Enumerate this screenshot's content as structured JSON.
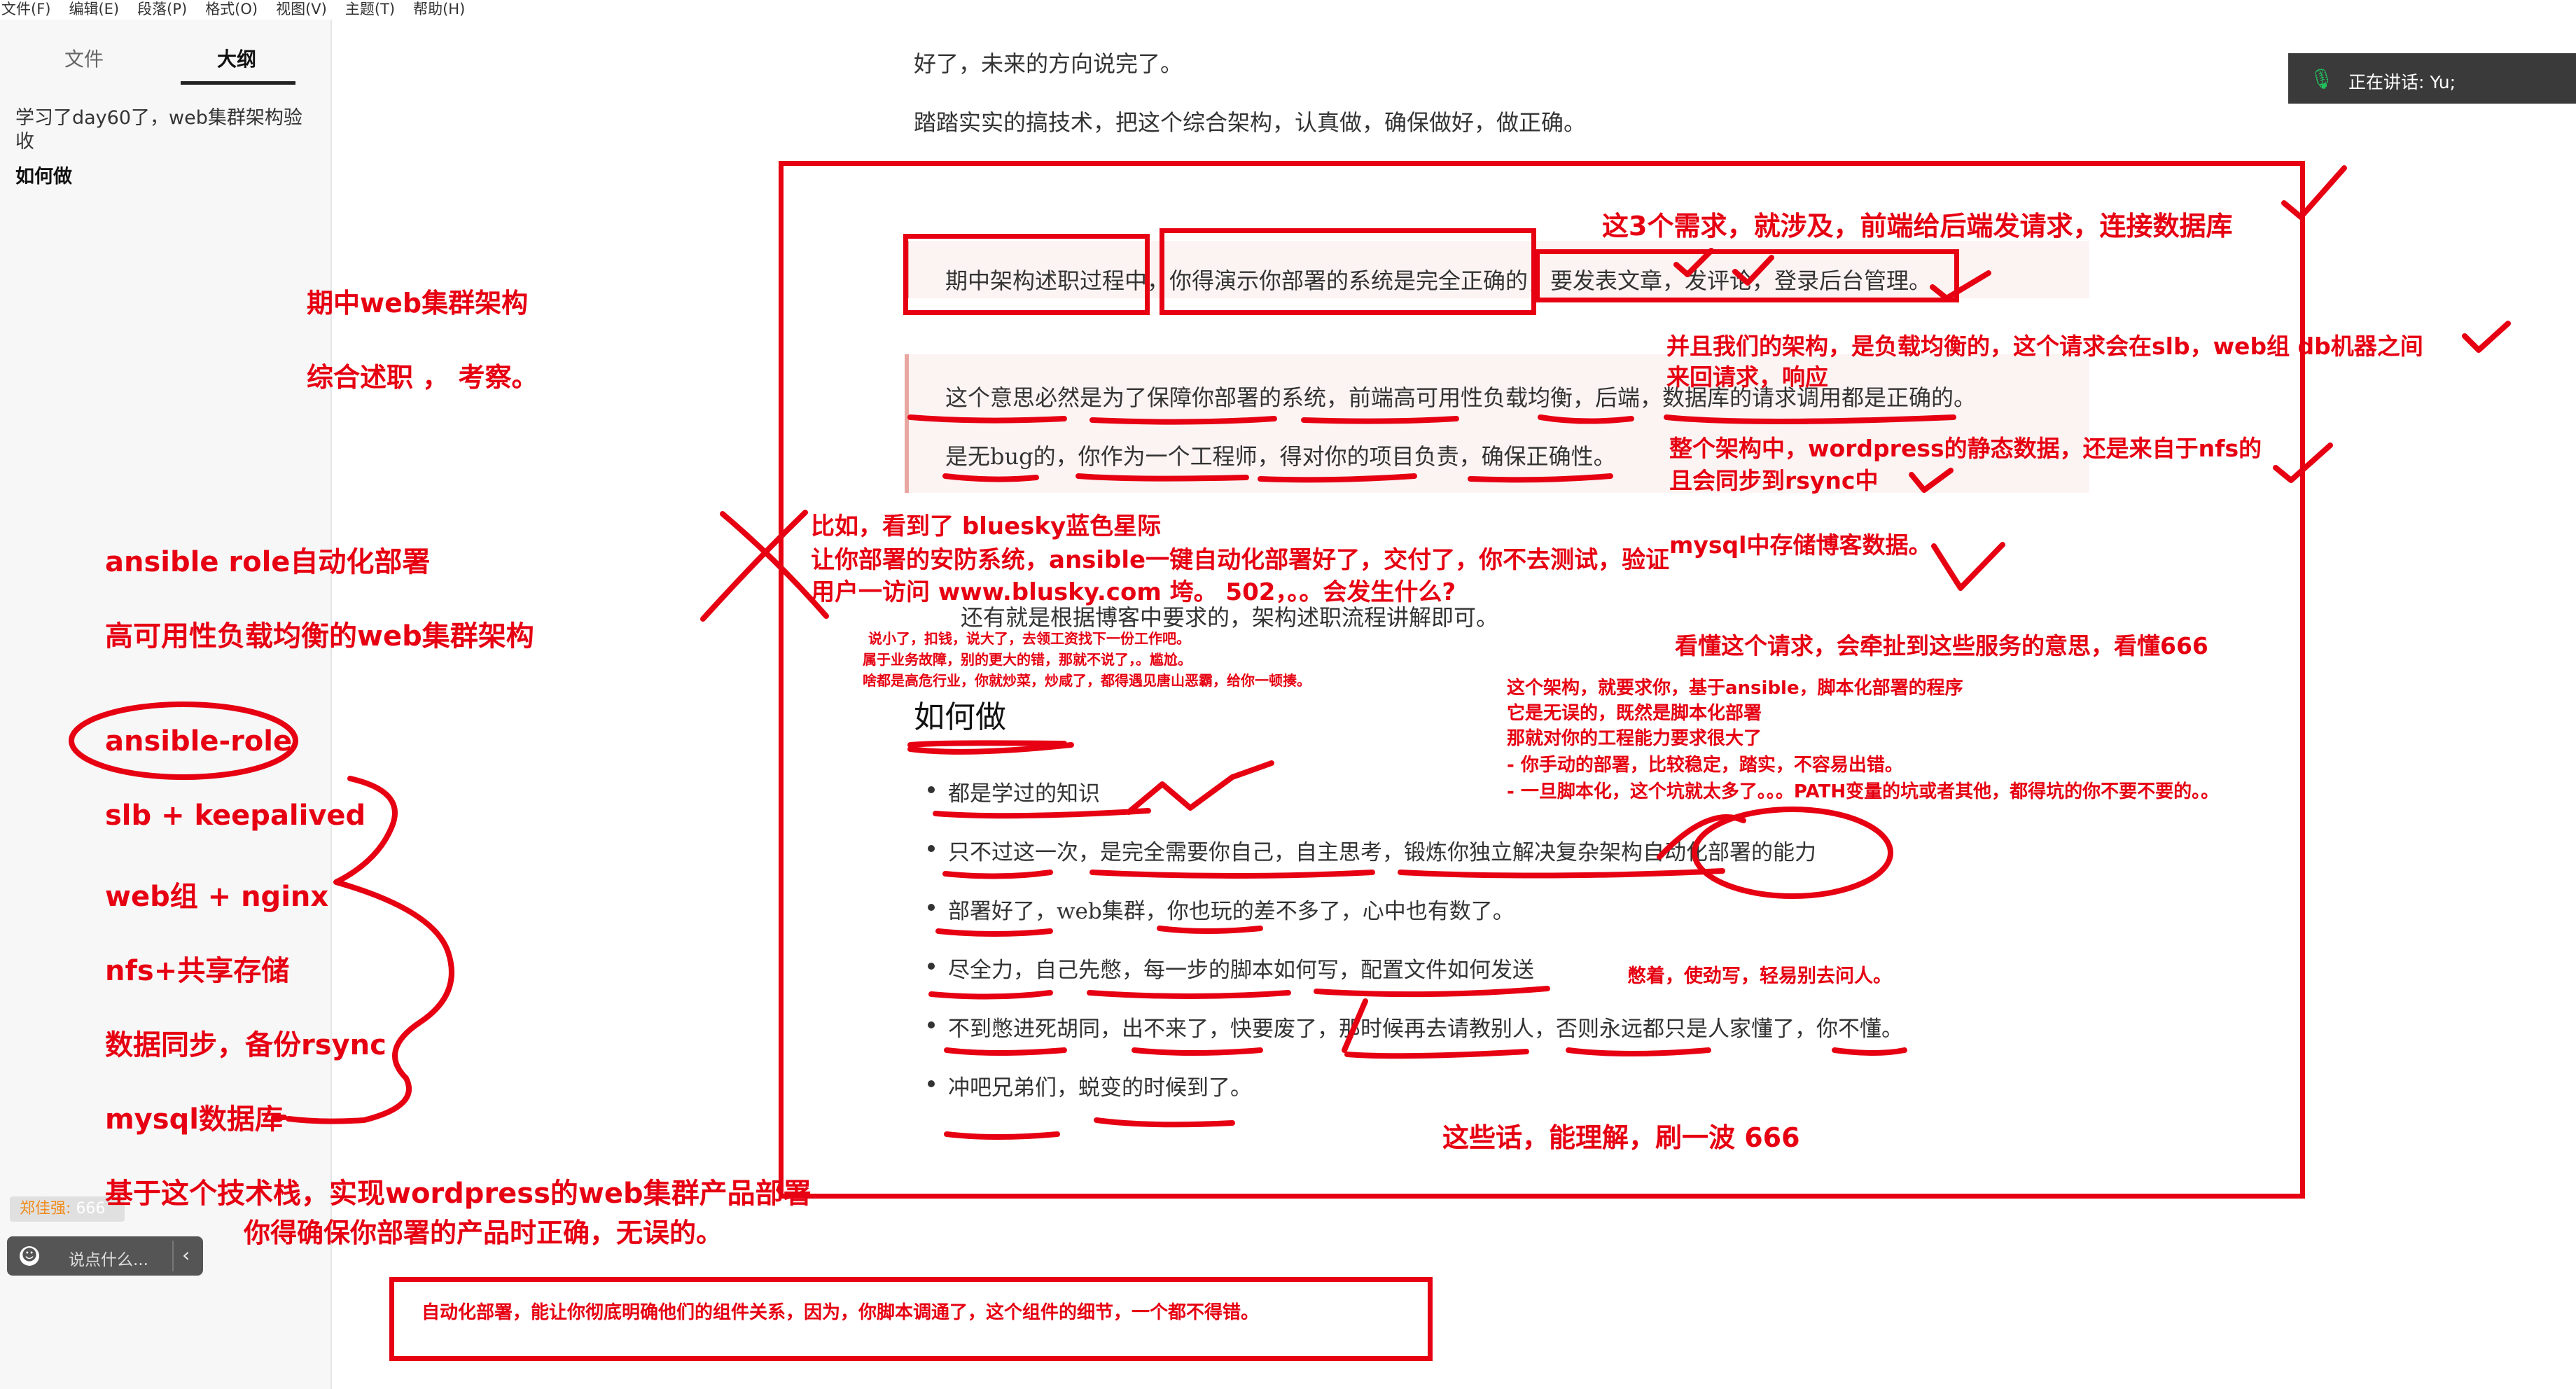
{
  "menu": [
    "文件(F)",
    "编辑(E)",
    "段落(P)",
    "格式(O)",
    "视图(V)",
    "主题(T)",
    "帮助(H)"
  ],
  "sidebar": {
    "tabs": [
      "文件",
      "大纲"
    ],
    "outline_items": [
      "学习了day60了，web集群架构验收",
      "如何做"
    ]
  },
  "speaking": {
    "label": "正在讲话: Yu;"
  },
  "chat": {
    "user": "郑佳强:",
    "message": "666",
    "placeholder": "说点什么..."
  },
  "doc": {
    "p1": "好了，未来的方向说完了。",
    "p2": "踏踏实实的搞技术，把这个综合架构，认真做，确保做好，做正确。",
    "quote1": "期中架构述职过程中，你得演示你部署的系统是完全正确的，要发表文章，发评论，登录后台管理。",
    "quote2a": "这个意思必然是为了保障你部署的系统，前端高可用性负载均衡，后端，数据库的请求调用都是正确的。",
    "quote2b": "是无bug的，你作为一个工程师，得对你的项目负责，确保正确性。",
    "p3": "还有就是根据博客中要求的，架构述职流程讲解即可。",
    "heading": "如何做",
    "list": [
      "都是学过的知识",
      "只不过这一次，是完全需要你自己，自主思考，锻炼你独立解决复杂架构自动化部署的能力",
      "部署好了，web集群，你也玩的差不多了，心中也有数了。",
      "尽全力，自己先憋，每一步的脚本如何写，配置文件如何发送",
      "不到憋进死胡同，出不来了，快要废了，那时候再去请教别人，否则永远都只是人家懂了，你不懂。",
      "冲吧兄弟们，蜕变的时候到了。"
    ]
  },
  "annotations": {
    "left": {
      "a1": "期中web集群架构",
      "a2": "综合述职 ， 考察。",
      "a3": "ansible role自动化部署",
      "a4": "高可用性负载均衡的web集群架构",
      "stack": [
        "ansible-role",
        "slb + keepalived",
        "web组 + nginx",
        "nfs+共享存储",
        "数据同步，备份rsync",
        "mysql数据库"
      ],
      "b1": "基于这个技术栈，实现wordpress的web集群产品部署",
      "b2": "你得确保你部署的产品时正确，无误的。"
    },
    "right": {
      "r1": "这3个需求，就涉及，前端给后端发请求，连接数据库",
      "r2a": "并且我们的架构，是负载均衡的，这个请求会在slb，web组 db机器之间",
      "r2b": "来回请求，响应",
      "r3a": "整个架构中，wordpress的静态数据，还是来自于nfs的",
      "r3b": "且会同步到rsync中",
      "r4": "mysql中存储博客数据。",
      "r5": "看懂这个请求，会牵扯到这些服务的意思，看懂666",
      "r6": [
        "这个架构，就要求你，基于ansible，脚本化部署的程序",
        "它是无误的，既然是脚本化部署",
        "那就对你的工程能力要求很大了",
        "- 你手动的部署，比较稳定，踏实，不容易出错。",
        "- 一旦脚本化，这个坑就太多了。。。PATH变量的坑或者其他，都得坑的你不要不要的。。"
      ],
      "r7": "憋着，使劲写，轻易别去问人。",
      "r8": "这些话，能理解，刷一波  666"
    },
    "middle": {
      "m1": [
        "比如，看到了 bluesky蓝色星际",
        "让你部署的安防系统，ansible一键自动化部署好了，交付了，你不去测试，验证",
        "用户一访问  www.blusky.com 垮。  502，。。会发生什么?"
      ],
      "m2": [
        "说小了，扣钱，说大了，去领工资找下一份工作吧。",
        "属于业务故障，别的更大的错，那就不说了，。尴尬。",
        "啥都是高危行业，你就炒菜，炒咸了，都得遇见唐山恶霸，给你一顿揍。"
      ]
    },
    "bottom": "自动化部署，能让你彻底明确他们的组件关系，因为，你脚本调通了，这个组件的细节，一个都不得错。"
  },
  "colors": {
    "ink": "#e60012",
    "quote_bar": "#e8a6a0",
    "accent_orange": "#f08c1e"
  }
}
